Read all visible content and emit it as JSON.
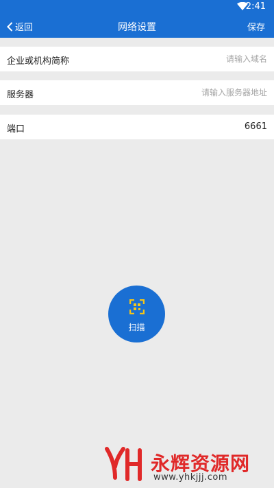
{
  "status_bar": {
    "time": "2:41"
  },
  "header": {
    "back_label": "返回",
    "title": "网络设置",
    "save_label": "保存"
  },
  "form": {
    "company": {
      "label": "企业或机构简称",
      "placeholder": "请输入域名",
      "value": ""
    },
    "server": {
      "label": "服务器",
      "placeholder": "请输入服务器地址",
      "value": ""
    },
    "port": {
      "label": "端口",
      "value": "6661"
    }
  },
  "scan_button": {
    "label": "扫描"
  },
  "watermark": {
    "name": "永辉资源网",
    "url": "www.yhkjjj.com"
  },
  "colors": {
    "primary": "#1a6fd3",
    "icon_accent": "#f5c518",
    "background": "#ebebeb",
    "watermark": "#e02929"
  }
}
